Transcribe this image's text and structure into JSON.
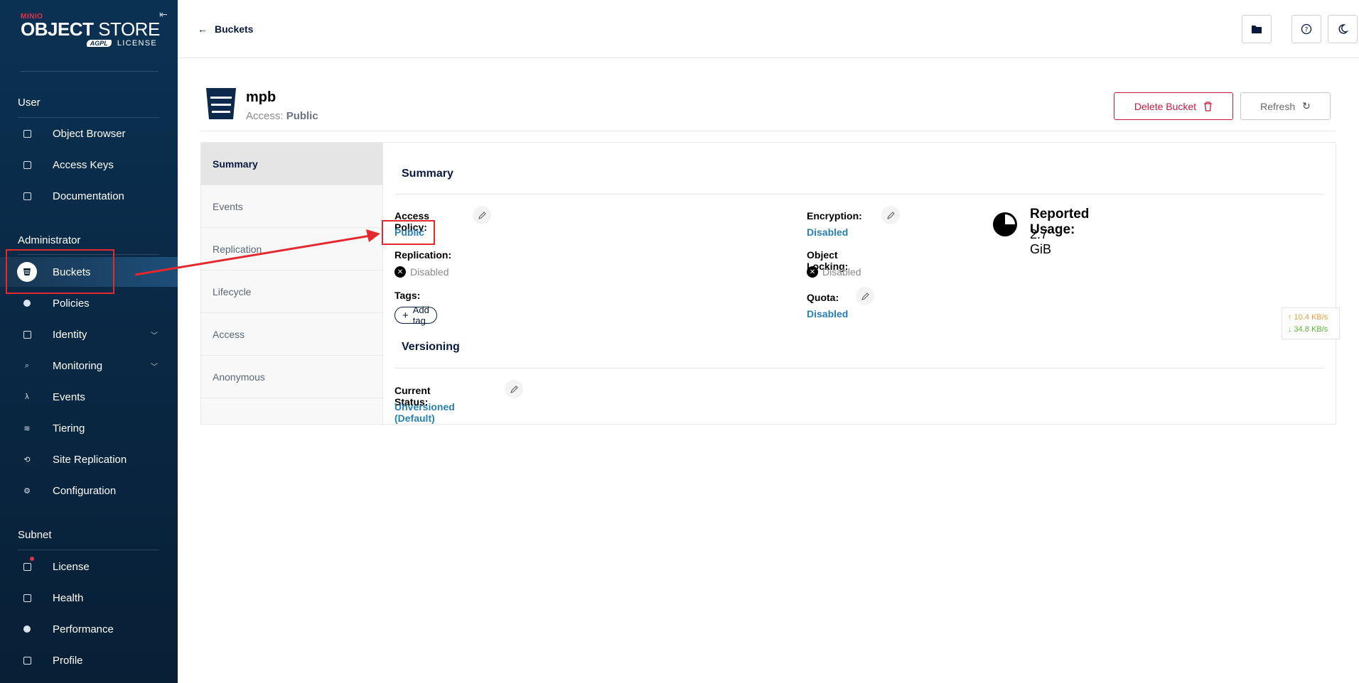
{
  "sidebar": {
    "brand": "MINIO",
    "product_bold": "OBJECT",
    "product_rest": " STORE",
    "agpl": "AGPL",
    "license_tag": "LICENSE",
    "sections": {
      "user": "User",
      "administrator": "Administrator",
      "subnet": "Subnet"
    },
    "items": [
      {
        "label": "Object Browser"
      },
      {
        "label": "Access Keys"
      },
      {
        "label": "Documentation"
      },
      {
        "label": "Buckets"
      },
      {
        "label": "Policies"
      },
      {
        "label": "Identity"
      },
      {
        "label": "Monitoring"
      },
      {
        "label": "Events"
      },
      {
        "label": "Tiering"
      },
      {
        "label": "Site Replication"
      },
      {
        "label": "Configuration"
      },
      {
        "label": "License"
      },
      {
        "label": "Health"
      },
      {
        "label": "Performance"
      },
      {
        "label": "Profile"
      }
    ]
  },
  "topbar": {
    "back_label": "Buckets"
  },
  "bucket": {
    "name": "mpb",
    "access_prefix": "Access:",
    "access_value": "Public",
    "delete_label": "Delete Bucket",
    "refresh_label": "Refresh"
  },
  "tabs": [
    "Summary",
    "Events",
    "Replication",
    "Lifecycle",
    "Access",
    "Anonymous"
  ],
  "summary": {
    "title": "Summary",
    "access_policy_label": "Access Policy:",
    "access_policy_value": "Public",
    "replication_label": "Replication:",
    "replication_value": "Disabled",
    "tags_label": "Tags:",
    "add_tag_label": "Add tag",
    "encryption_label": "Encryption:",
    "encryption_value": "Disabled",
    "object_locking_label": "Object Locking:",
    "object_locking_value": "Disabled",
    "quota_label": "Quota:",
    "quota_value": "Disabled",
    "reported_usage_label": "Reported Usage:",
    "reported_usage_value": "2.7 GiB"
  },
  "versioning": {
    "title": "Versioning",
    "status_label": "Current Status:",
    "status_value": "Unversioned (Default)"
  },
  "speed": {
    "up": "↑ 10.4 KB/s",
    "down": "↓ 34.8 KB/s"
  },
  "colors": {
    "sidebar_bg": "#0b2a4a",
    "accent_link": "#2781b0",
    "danger": "#c51b3f",
    "annotation": "#e3282e"
  }
}
